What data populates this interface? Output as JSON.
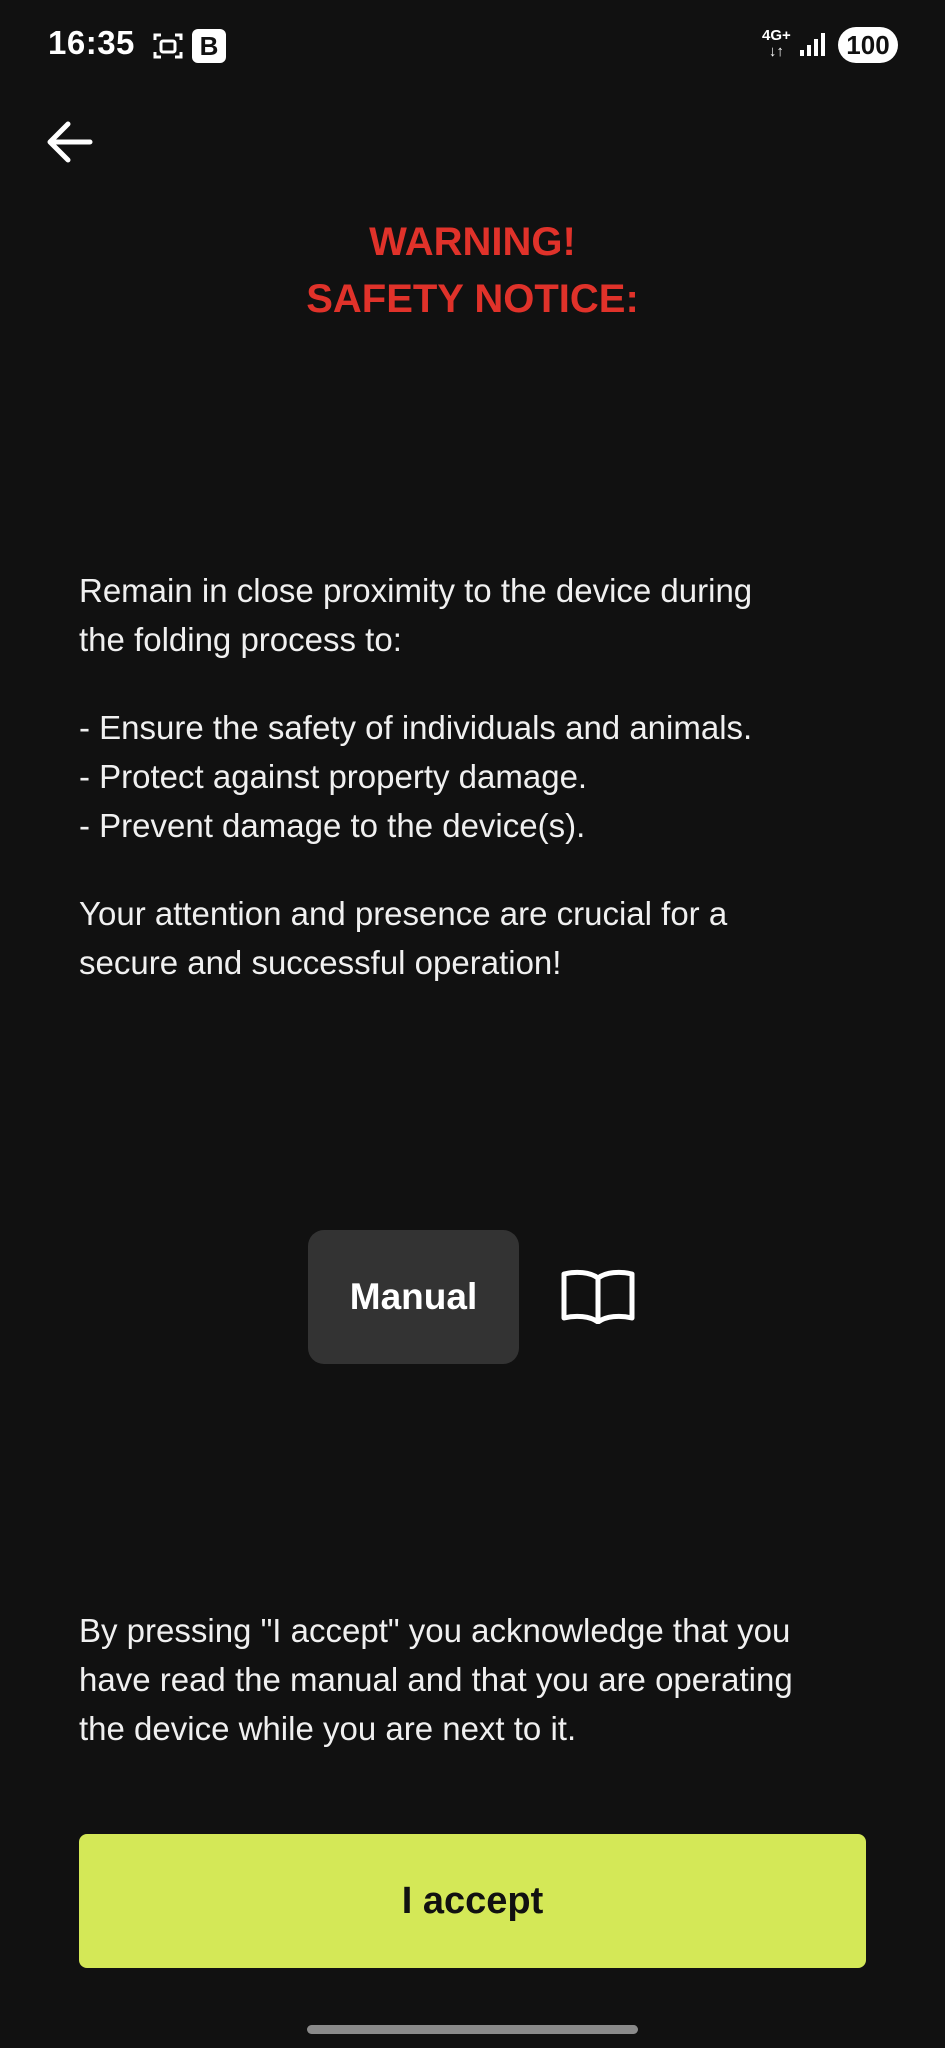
{
  "status_bar": {
    "time": "16:35",
    "b_badge": "B",
    "network_top": "4G+",
    "network_bottom": "↓↑",
    "battery": "100"
  },
  "header": {
    "back_icon": "arrow-left-icon",
    "title_line1": "WARNING!",
    "title_line2": "SAFETY NOTICE:"
  },
  "content": {
    "intro_line1": "Remain in close proximity to the device during",
    "intro_line2": "the folding process to:",
    "bullets": [
      "- Ensure the safety of individuals and animals.",
      "- Protect against property damage.",
      "- Prevent damage to the device(s)."
    ],
    "attention_line1": "Your attention and presence are crucial for a",
    "attention_line2": "secure and successful operation!",
    "manual_label": "Manual",
    "manual_icon": "book-open-icon",
    "ack_line1": "By pressing \"I accept\" you acknowledge that you",
    "ack_line2": "have read the manual and that you are operating",
    "ack_line3": "the device while you are next to it."
  },
  "actions": {
    "accept_label": "I accept"
  },
  "colors": {
    "background": "#111111",
    "warning": "#e0322a",
    "accept": "#d4e857",
    "manual_bg": "#333333"
  }
}
